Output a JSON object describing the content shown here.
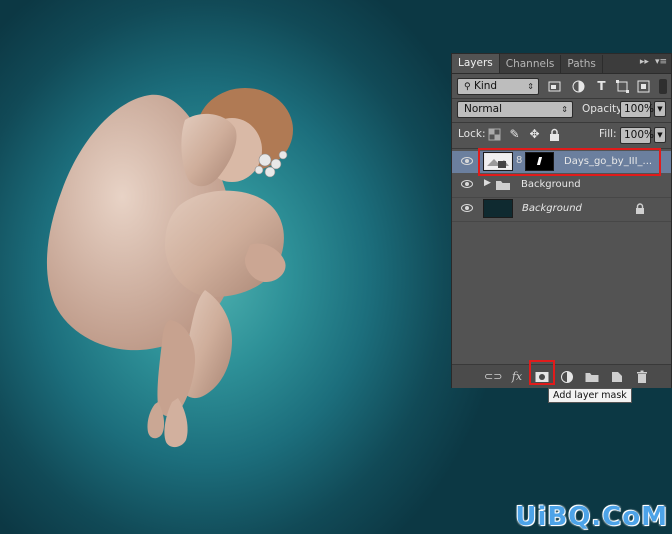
{
  "panel": {
    "tabs": [
      "Layers",
      "Channels",
      "Paths"
    ],
    "filter_kind": "Kind",
    "blend_mode": "Normal",
    "opacity_label": "Opacity:",
    "opacity_value": "100%",
    "lock_label": "Lock:",
    "fill_label": "Fill:",
    "fill_value": "100%",
    "layers": [
      {
        "name": "Days_go_by_III_...",
        "type": "smart-object-with-mask",
        "selected": true
      },
      {
        "name": "Background",
        "type": "group",
        "selected": false
      },
      {
        "name": "Background",
        "type": "background-locked",
        "selected": false
      }
    ]
  },
  "tooltip": "Add layer mask",
  "watermark": "UiBQ.CoM",
  "colors": {
    "highlight": "#e11b1b",
    "selected_layer": "#6b7f9e",
    "panel_bg": "#535353"
  }
}
